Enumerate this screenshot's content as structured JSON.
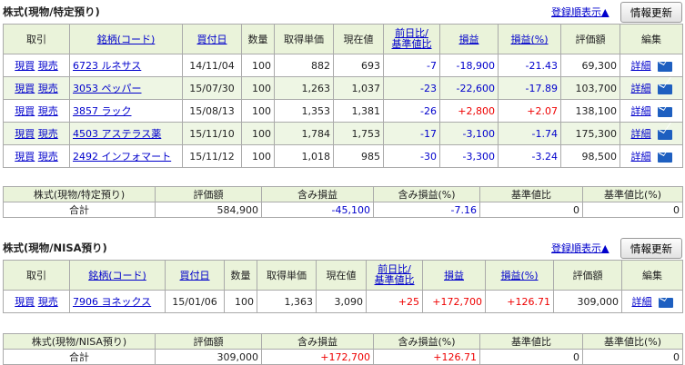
{
  "spec": {
    "title": "株式(現物/特定預り)",
    "sort_link": "登録順表示▲",
    "refresh_button": "情報更新",
    "headers": [
      "取引",
      "銘柄(コード)",
      "買付日",
      "数量",
      "取得単価",
      "現在値",
      "前日比/\n基準値比",
      "損益",
      "損益(%)",
      "評価額",
      "編集"
    ],
    "rows": [
      {
        "buy": "現買",
        "sell": "現売",
        "name": "6723 ルネサス",
        "date": "14/11/04",
        "qty": "100",
        "cost": "882",
        "price": "693",
        "change": "-7",
        "pl": "-18,900",
        "pl_pct": "-21.43",
        "value": "69,300",
        "detail": "詳細"
      },
      {
        "buy": "現買",
        "sell": "現売",
        "name": "3053 ペッパー",
        "date": "15/07/30",
        "qty": "100",
        "cost": "1,263",
        "price": "1,037",
        "change": "-23",
        "pl": "-22,600",
        "pl_pct": "-17.89",
        "value": "103,700",
        "detail": "詳細"
      },
      {
        "buy": "現買",
        "sell": "現売",
        "name": "3857 ラック",
        "date": "15/08/13",
        "qty": "100",
        "cost": "1,353",
        "price": "1,381",
        "change": "-26",
        "pl": "+2,800",
        "pl_pct": "+2.07",
        "value": "138,100",
        "detail": "詳細"
      },
      {
        "buy": "現買",
        "sell": "現売",
        "name": "4503 アステラス薬",
        "date": "15/11/10",
        "qty": "100",
        "cost": "1,784",
        "price": "1,753",
        "change": "-17",
        "pl": "-3,100",
        "pl_pct": "-1.74",
        "value": "175,300",
        "detail": "詳細"
      },
      {
        "buy": "現買",
        "sell": "現売",
        "name": "2492 インフォマート",
        "date": "15/11/12",
        "qty": "100",
        "cost": "1,018",
        "price": "985",
        "change": "-30",
        "pl": "-3,300",
        "pl_pct": "-3.24",
        "value": "98,500",
        "detail": "詳細"
      }
    ],
    "summary": {
      "label1": "株式(現物/特定預り)",
      "label2": "合計",
      "headers": [
        "評価額",
        "含み損益",
        "含み損益(%)",
        "基準値比",
        "基準値比(%)"
      ],
      "values": [
        "584,900",
        "-45,100",
        "-7.16",
        "0",
        "0"
      ]
    }
  },
  "nisa": {
    "title": "株式(現物/NISA預り)",
    "sort_link": "登録順表示▲",
    "refresh_button": "情報更新",
    "headers": [
      "取引",
      "銘柄(コード)",
      "買付日",
      "数量",
      "取得単価",
      "現在値",
      "前日比/\n基準値比",
      "損益",
      "損益(%)",
      "評価額",
      "編集"
    ],
    "rows": [
      {
        "buy": "現買",
        "sell": "現売",
        "name": "7906 ヨネックス",
        "date": "15/01/06",
        "qty": "100",
        "cost": "1,363",
        "price": "3,090",
        "change": "+25",
        "pl": "+172,700",
        "pl_pct": "+126.71",
        "value": "309,000",
        "detail": "詳細"
      }
    ],
    "summary": {
      "label1": "株式(現物/NISA預り)",
      "label2": "合計",
      "headers": [
        "評価額",
        "含み損益",
        "含み損益(%)",
        "基準値比",
        "基準値比(%)"
      ],
      "values": [
        "309,000",
        "+172,700",
        "+126.71",
        "0",
        "0"
      ]
    }
  },
  "colors": {
    "header_bg": "#eaf3da",
    "row_alt_bg": "#eef6e4",
    "negative": "#0000cc",
    "positive": "#ee0000",
    "link": "#0000cc"
  },
  "icons": {
    "edit": "mail-icon"
  }
}
